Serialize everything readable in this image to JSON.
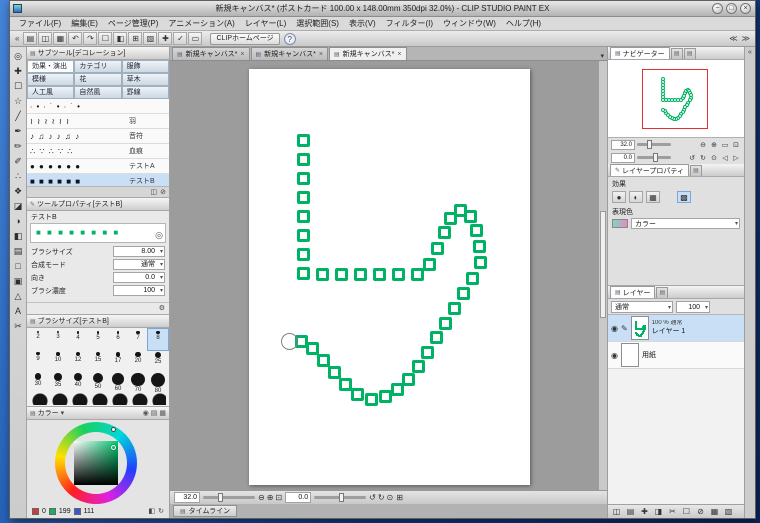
{
  "ui": {
    "caret": "▾",
    "grip": "▤",
    "close": "×",
    "eye": "◉",
    "pen": "✎",
    "target": "◎",
    "chev_left": "«",
    "chev_dbl_left": "≪",
    "chev_dbl_right": "≫",
    "min": "−",
    "max": "□",
    "x": "×",
    "fit": "⊞"
  },
  "window": {
    "title": "新規キャンバス* (ポストカード 100.00 x 148.00mm 350dpi 32.0%) - CLIP STUDIO PAINT EX"
  },
  "menu": {
    "items": [
      "ファイル(F)",
      "編集(E)",
      "ページ管理(P)",
      "アニメーション(A)",
      "レイヤー(L)",
      "選択範囲(S)",
      "表示(V)",
      "フィルター(I)",
      "ウィンドウ(W)",
      "ヘルプ(H)"
    ]
  },
  "cmdbar": {
    "icons": [
      "▤",
      "◫",
      "▦",
      "↶",
      "↷",
      "☐",
      "◧",
      "⊞",
      "▧",
      "✚",
      "✓",
      "▭"
    ],
    "home_button": "CLIPホームページ",
    "help_icon": "?"
  },
  "toolstrip": {
    "tools": [
      {
        "name": "zoom-tool",
        "glyph": "◎"
      },
      {
        "name": "move-tool",
        "glyph": "✚"
      },
      {
        "name": "selection-tool",
        "glyph": "☐"
      },
      {
        "name": "auto-select-tool",
        "glyph": "☆"
      },
      {
        "name": "eyedropper-tool",
        "glyph": "╱"
      },
      {
        "name": "pen-tool",
        "glyph": "✒"
      },
      {
        "name": "pencil-tool",
        "glyph": "✏"
      },
      {
        "name": "brush-tool",
        "glyph": "✐"
      },
      {
        "name": "airbrush-tool",
        "glyph": "∴"
      },
      {
        "name": "decoration-tool",
        "glyph": "❖"
      },
      {
        "name": "eraser-tool",
        "glyph": "◪"
      },
      {
        "name": "blend-tool",
        "glyph": "◑"
      },
      {
        "name": "fill-tool",
        "glyph": "◧"
      },
      {
        "name": "gradient-tool",
        "glyph": "▤"
      },
      {
        "name": "figure-tool",
        "glyph": "□"
      },
      {
        "name": "frame-tool",
        "glyph": "▣"
      },
      {
        "name": "ruler-tool",
        "glyph": "△"
      },
      {
        "name": "text-tool",
        "glyph": "A"
      },
      {
        "name": "line-correction-tool",
        "glyph": "✂"
      }
    ],
    "fg_color": "#00c76f"
  },
  "subtool": {
    "header": "サブツール[デコレーション]",
    "categories": [
      "効果・演出",
      "カテゴリ",
      "服飾",
      "模様",
      "花",
      "草木",
      "人工風",
      "自然風",
      "罫線"
    ],
    "brushes": [
      {
        "label": "",
        "preview": "∙ • ∙ ˙ • ∙ ˙ •"
      },
      {
        "label": "羽",
        "preview": "≀ ≀ ≀ ≀ ≀ ≀"
      },
      {
        "label": "音符",
        "preview": "♪ ♫ ♪ ♪ ♫ ♪"
      },
      {
        "label": "血痕",
        "preview": "∴ ∵ ∴ ∵ ∴"
      },
      {
        "label": "テストA",
        "preview": "● ● ● ● ● ●"
      },
      {
        "label": "テストB",
        "preview": "■ ■ ■ ■ ■ ■"
      }
    ],
    "footer_icons": [
      "◫",
      "⊘"
    ]
  },
  "tool_property": {
    "header": "ツールプロパティ[テストB]",
    "name": "テストB",
    "preview": "■ ■ ■ ■ ■ ■ ■ ■",
    "rows": [
      {
        "label": "ブラシサイズ",
        "value": "8.00"
      },
      {
        "label": "合成モード",
        "value": "通常"
      },
      {
        "label": "向き",
        "value": "0.0"
      },
      {
        "label": "ブラシ濃度",
        "value": "100"
      }
    ],
    "footer_icon": "⚙"
  },
  "brush_size": {
    "header": "ブラシサイズ[テストB]",
    "sizes": [
      2,
      3,
      4,
      5,
      6,
      7,
      8,
      9,
      10,
      12,
      15,
      17,
      20,
      25,
      30,
      35,
      40,
      50,
      60,
      70,
      80
    ],
    "selected": 8
  },
  "color": {
    "header": "カラー",
    "header_icons": [
      "◉",
      "▤",
      "▦"
    ],
    "r": "0",
    "g": "199",
    "b": "111",
    "current": "#00c76f",
    "icons": [
      "◧",
      "↻"
    ]
  },
  "canvas": {
    "tabs": [
      "新規キャンバス*",
      "新規キャンバス*",
      "新規キャンバス*"
    ],
    "zoom": "32.0",
    "rotation": "0.0",
    "zoom_icons": [
      "⊖",
      "⊕",
      "⊡"
    ],
    "rot_icons": [
      "↺",
      "↻",
      "⊙"
    ],
    "fit_icon": "⊞",
    "timeline": "タイムライン"
  },
  "artwork": {
    "color": "#00b264",
    "squares": [
      [
        54,
        71
      ],
      [
        54,
        90
      ],
      [
        54,
        109
      ],
      [
        54,
        128
      ],
      [
        54,
        147
      ],
      [
        54,
        166
      ],
      [
        54,
        185
      ],
      [
        54,
        204
      ],
      [
        73,
        205
      ],
      [
        92,
        205
      ],
      [
        111,
        205
      ],
      [
        130,
        205
      ],
      [
        149,
        205
      ],
      [
        168,
        205
      ],
      [
        180,
        195
      ],
      [
        188,
        179
      ],
      [
        195,
        163
      ],
      [
        201,
        149
      ],
      [
        211,
        141
      ],
      [
        221,
        147
      ],
      [
        227,
        161
      ],
      [
        230,
        177
      ],
      [
        231,
        193
      ],
      [
        223,
        209
      ],
      [
        214,
        224
      ],
      [
        205,
        239
      ],
      [
        196,
        254
      ],
      [
        187,
        268
      ],
      [
        178,
        283
      ],
      [
        169,
        297
      ],
      [
        159,
        310
      ],
      [
        148,
        320
      ],
      [
        136,
        327
      ],
      [
        122,
        330
      ],
      [
        108,
        325
      ],
      [
        96,
        315
      ],
      [
        85,
        303
      ],
      [
        74,
        291
      ],
      [
        63,
        279
      ],
      [
        52,
        272
      ]
    ],
    "cursor": [
      41,
      273
    ]
  },
  "navigator": {
    "tab": "ナビゲーター",
    "zoom": "32.0",
    "rotation": "0.0",
    "zoom_icons": [
      "⊖",
      "⊕",
      "▭",
      "⊡"
    ],
    "rotate_icons": [
      "↺",
      "↻",
      "⊙",
      "◁",
      "▷"
    ]
  },
  "layer_prop": {
    "tab": "レイヤープロパティ",
    "effect_label": "効果",
    "effect_icons": [
      "●",
      "◐",
      "▦",
      "▩"
    ],
    "expression_label": "表現色",
    "expression_value": "カラー"
  },
  "layers": {
    "tab": "レイヤー",
    "blend": "通常",
    "opacity": "100",
    "items": [
      {
        "info": "100 % 通常",
        "name": "レイヤー 1"
      },
      {
        "info": "",
        "name": "用紙"
      }
    ],
    "bottom_icons": [
      "◫",
      "▤",
      "✚",
      "◨",
      "✂",
      "☐",
      "⊘",
      "▦",
      "▧"
    ]
  }
}
